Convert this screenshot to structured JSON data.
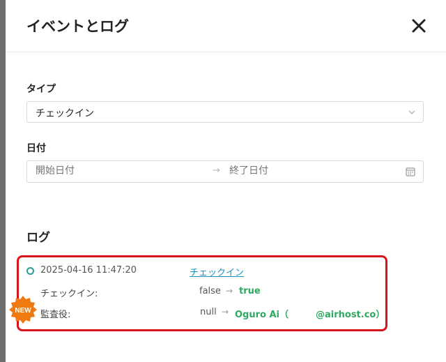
{
  "modal": {
    "title": "イベントとログ",
    "close_icon": "close-icon"
  },
  "filters": {
    "type_label": "タイプ",
    "type_value": "チェックイン",
    "date_label": "日付",
    "start_placeholder": "開始日付",
    "separator": "→",
    "end_placeholder": "終了日付"
  },
  "log": {
    "title": "ログ",
    "entries": [
      {
        "timestamp": "2025-04-16 11:47:20",
        "event_link": "チェックイン",
        "changes": [
          {
            "field": "チェックイン:",
            "old": "false",
            "arrow": "→",
            "new": "true"
          },
          {
            "field": "監査役:",
            "old": "null",
            "arrow": "→",
            "new": "Oguro Ai（　　　@airhost.co）"
          }
        ]
      }
    ]
  },
  "badge": {
    "label": "NEW",
    "color": "#f07a12"
  },
  "colors": {
    "accent": "#1f8fbf",
    "new_value": "#2fa860",
    "highlight": "#d8141b",
    "dot": "#2a9d8f"
  }
}
